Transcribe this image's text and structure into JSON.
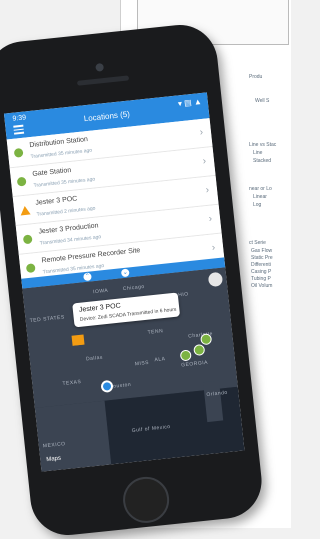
{
  "status_bar": {
    "time": "9:39",
    "icons": "▾ ▤ ▲"
  },
  "header": {
    "title": "Locations (5)"
  },
  "locations": [
    {
      "name": "Distribution Station",
      "sub": "Transmitted 35 minutes ago",
      "status": "ok"
    },
    {
      "name": "Gate Station",
      "sub": "Transmitted 35 minutes ago",
      "status": "ok"
    },
    {
      "name": "Jester 3 POC",
      "sub": "Transmitted 2 minutes ago",
      "status": "warn"
    },
    {
      "name": "Jester 3 Production",
      "sub": "Transmitted 34 minutes ago",
      "status": "ok"
    },
    {
      "name": "Remote Pressure Recorder Site",
      "sub": "Transmitted 35 minutes ago",
      "status": "ok"
    }
  ],
  "map": {
    "tooltip_title": "Jester 3 POC",
    "tooltip_sub": "Device: Zedi SCADA Transmitted in 6 hours",
    "labels": [
      "IOWA",
      "Chicago",
      "OHIO",
      "TED STATES",
      "TENN",
      "Charlotte",
      "ALA",
      "Dallas",
      "TEXAS",
      "MISS",
      "GEORGIA",
      "Houston",
      "Orlando",
      "Gulf of Mexico",
      "MEXICO"
    ],
    "maps_label": "Maps"
  },
  "background_doc": {
    "items": [
      "Produ",
      "Well S",
      "Line vs Stac",
      "Line",
      "Stacked",
      "near or Lo",
      "Linear",
      "Log",
      "ct Serie",
      "Gas Flow",
      "Static Pre",
      "Differenti",
      "Casing P",
      "Tubing P",
      "Oil Volum"
    ]
  },
  "colors": {
    "accent": "#2a8ae0",
    "ok": "#7cb342",
    "warn": "#f39c12"
  }
}
